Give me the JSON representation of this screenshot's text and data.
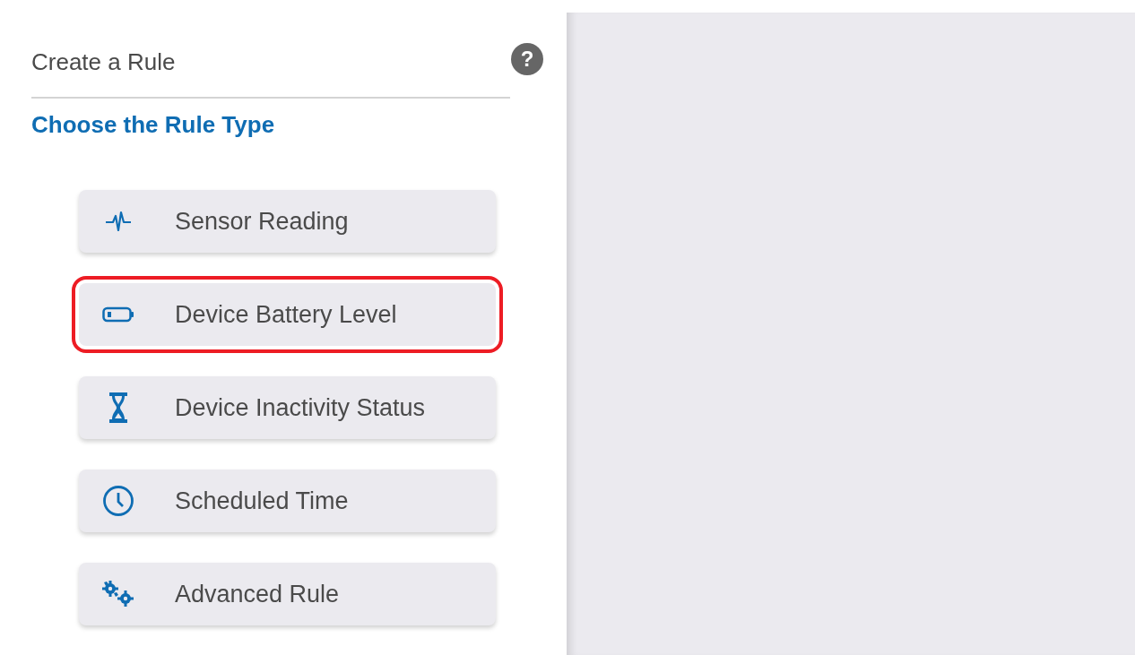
{
  "panel": {
    "title": "Create a Rule",
    "subtitle": "Choose the Rule Type",
    "help_button": "?"
  },
  "options": [
    {
      "kind": "pulse",
      "label": "Sensor Reading",
      "highlighted": false
    },
    {
      "kind": "battery",
      "label": "Device Battery Level",
      "highlighted": true
    },
    {
      "kind": "hourglass",
      "label": "Device Inactivity Status",
      "highlighted": false
    },
    {
      "kind": "clock",
      "label": "Scheduled Time",
      "highlighted": false
    },
    {
      "kind": "gears",
      "label": "Advanced Rule",
      "highlighted": false
    }
  ]
}
